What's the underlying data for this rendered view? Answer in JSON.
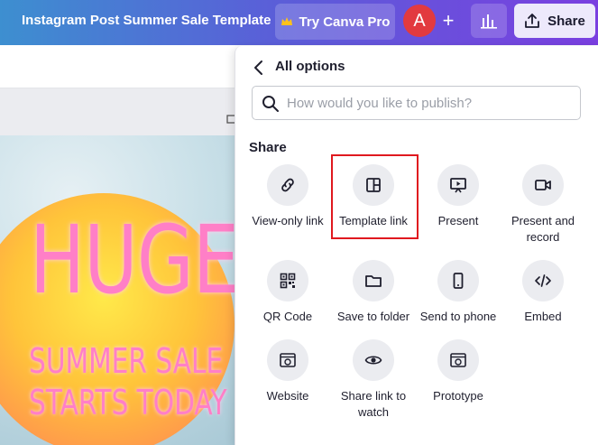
{
  "topbar": {
    "title": "Instagram Post Summer Sale Template",
    "pro_label": "Try Canva Pro",
    "avatar_letter": "A",
    "plus": "+",
    "share_label": "Share"
  },
  "design": {
    "headline": "HUGE",
    "line1": "SUMMER SALE",
    "line2": "STARTS TODAY"
  },
  "panel": {
    "title": "All options",
    "search_placeholder": "How would you like to publish?",
    "section": "Share",
    "options": [
      {
        "label": "View-only link",
        "icon": "link-icon"
      },
      {
        "label": "Template link",
        "icon": "template-icon"
      },
      {
        "label": "Present",
        "icon": "present-icon"
      },
      {
        "label": "Present and record",
        "icon": "video-camera-icon"
      },
      {
        "label": "QR Code",
        "icon": "qr-code-icon"
      },
      {
        "label": "Save to folder",
        "icon": "folder-icon"
      },
      {
        "label": "Send to phone",
        "icon": "phone-icon"
      },
      {
        "label": "Embed",
        "icon": "code-icon"
      },
      {
        "label": "Website",
        "icon": "website-icon"
      },
      {
        "label": "Share link to watch",
        "icon": "eye-icon"
      },
      {
        "label": "Prototype",
        "icon": "prototype-icon"
      }
    ]
  },
  "colors": {
    "accent": "#7a3fe0",
    "highlight": "#e0191f",
    "share_bg": "#ede9fb"
  }
}
